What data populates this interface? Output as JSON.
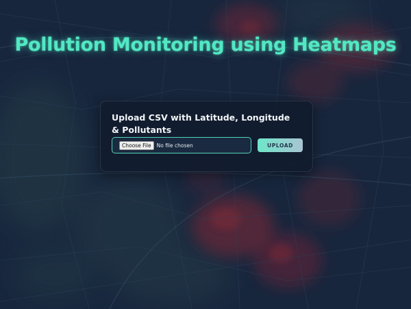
{
  "page": {
    "title": "Pollution Monitoring using Heatmaps"
  },
  "upload": {
    "heading": "Upload CSV with Latitude, Longitude & Pollutants",
    "choose_file_label": "Choose File",
    "file_status": "No file chosen",
    "upload_button_label": "UPLOAD"
  },
  "colors": {
    "accent": "#52e8c3",
    "background": "#1a2940",
    "heat": "#b02a3a"
  }
}
